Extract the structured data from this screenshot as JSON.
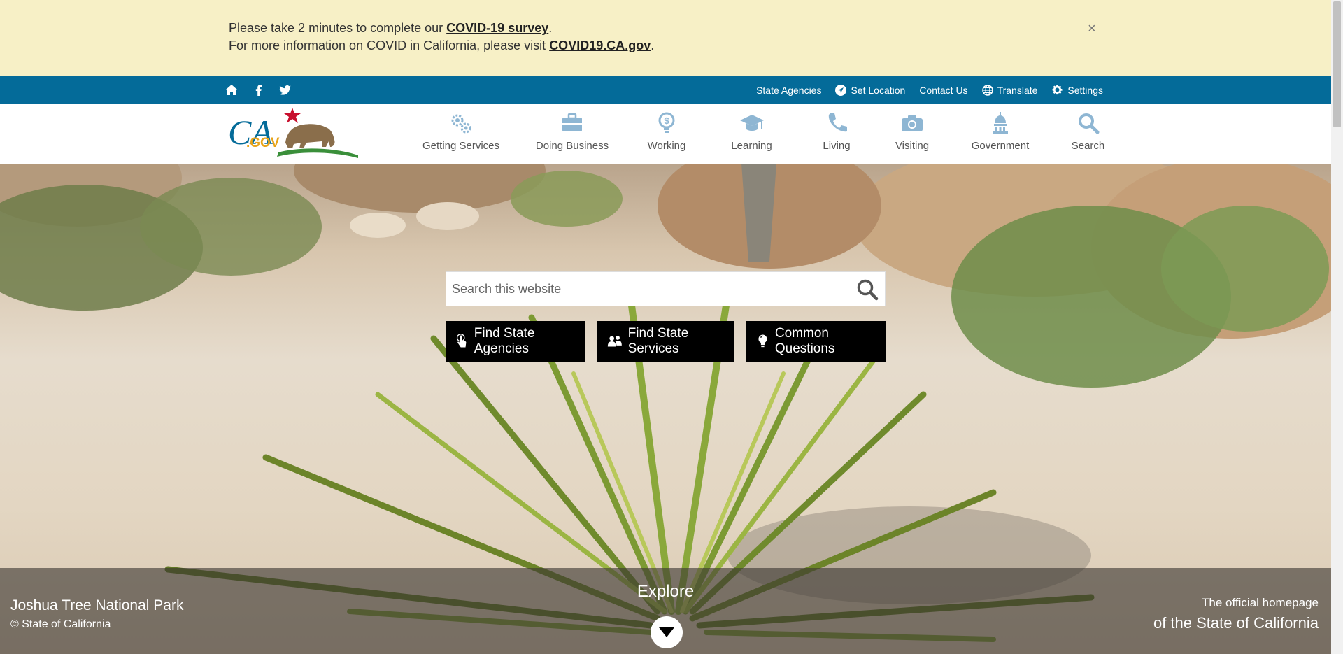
{
  "alert": {
    "line1_prefix": "Please take 2 minutes to complete our ",
    "line1_link": "COVID-19 survey",
    "line1_suffix": ".",
    "line2_prefix": "For more information on COVID in California, please visit ",
    "line2_link": "COVID19.CA.gov",
    "line2_suffix": ".",
    "close": "×"
  },
  "utility": {
    "links": [
      {
        "label": "State Agencies"
      },
      {
        "label": "Set Location",
        "icon": "location-icon"
      },
      {
        "label": "Contact Us"
      },
      {
        "label": "Translate",
        "icon": "globe-icon"
      },
      {
        "label": "Settings",
        "icon": "gear-icon"
      }
    ],
    "social": [
      "home-icon",
      "facebook-icon",
      "twitter-icon"
    ]
  },
  "logo": {
    "text": "CA",
    "subtext": ".GOV"
  },
  "nav": [
    {
      "label": "Getting Services",
      "icon": "gears-icon"
    },
    {
      "label": "Doing Business",
      "icon": "briefcase-icon"
    },
    {
      "label": "Working",
      "icon": "lightbulb-dollar-icon"
    },
    {
      "label": "Learning",
      "icon": "graduation-cap-icon"
    },
    {
      "label": "Living",
      "icon": "phone-icon"
    },
    {
      "label": "Visiting",
      "icon": "camera-icon"
    },
    {
      "label": "Government",
      "icon": "capitol-icon"
    },
    {
      "label": "Search",
      "icon": "search-icon"
    }
  ],
  "search": {
    "placeholder": "Search this website"
  },
  "cta": [
    {
      "label": "Find State Agencies"
    },
    {
      "label": "Find State Services"
    },
    {
      "label": "Common Questions"
    }
  ],
  "band": {
    "photo_title": "Joshua Tree National Park",
    "photo_credit": "© State of California",
    "explore": "Explore",
    "tagline1": "The official homepage",
    "tagline2": "of the State of California"
  },
  "colors": {
    "utility_bar": "#046b99",
    "alert_bg": "#f7f0c6",
    "nav_icon": "#8eb6d3",
    "brand_gold": "#e8a317"
  }
}
